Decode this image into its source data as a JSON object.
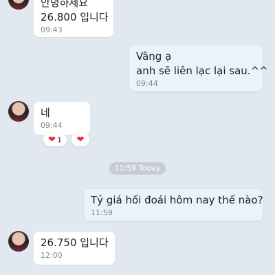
{
  "messages": [
    {
      "lines": [
        "안녕하세요",
        "26.800 입니다"
      ],
      "time": "09:43",
      "sender": "other"
    },
    {
      "lines": [
        "Vâng ạ",
        "anh sẽ liên lạc lại sau.^^"
      ],
      "time": "09:44",
      "sender": "me"
    },
    {
      "lines": [
        "네"
      ],
      "time": "09:44",
      "sender": "other",
      "reactions": [
        {
          "icon": "heart",
          "count": "1"
        },
        {
          "icon": "heart",
          "count": ""
        }
      ]
    },
    {
      "lines": [
        "Tỷ giá hối đoái hôm nay thế nào?"
      ],
      "time": "11:59",
      "sender": "me"
    },
    {
      "lines": [
        "26.750 입니다"
      ],
      "time": "12:00",
      "sender": "other"
    }
  ],
  "date_divider": "11:59 Today",
  "colors": {
    "background": "#e2e8ef",
    "incoming_bubble": "#ffffff",
    "outgoing_bubble": "#eaf3fb",
    "heart": "#e5333a"
  }
}
